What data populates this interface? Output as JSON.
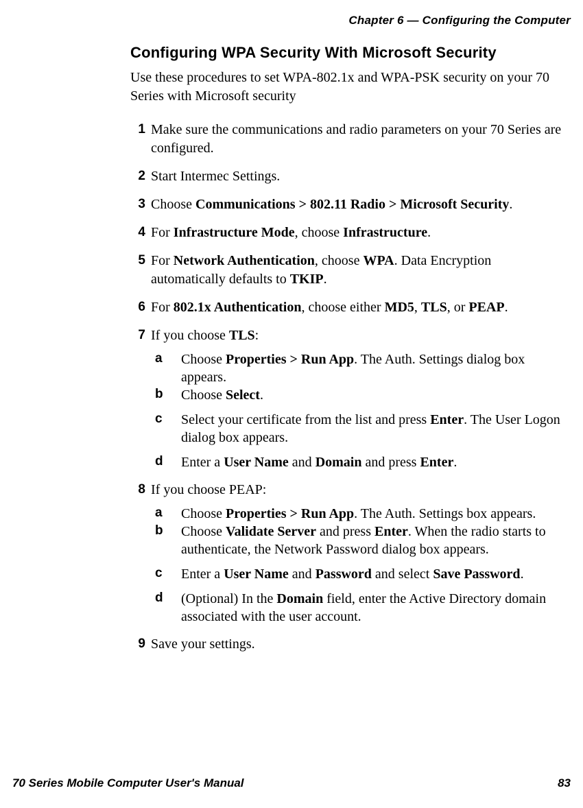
{
  "running_head": "Chapter 6 — Configuring the Computer",
  "section_title": "Configuring WPA Security With Microsoft Security",
  "intro": "Use these procedures to set WPA-802.1x and WPA-PSK security on your 70 Series with Microsoft security",
  "steps": {
    "s1": "Make sure the communications and radio parameters on your 70 Series are configured.",
    "s2": "Start Intermec Settings.",
    "s3_pre": "Choose ",
    "s3_bold": "Communications > 802.11 Radio > Microsoft Security",
    "s3_post": ".",
    "s4_a": "For ",
    "s4_b": "Infrastructure Mode",
    "s4_c": ", choose ",
    "s4_d": "Infrastructure",
    "s4_e": ".",
    "s5_a": "For ",
    "s5_b": "Network Authentication",
    "s5_c": ", choose ",
    "s5_d": "WPA",
    "s5_e": ". Data Encryption automatically defaults to ",
    "s5_f": "TKIP",
    "s5_g": ".",
    "s6_a": "For ",
    "s6_b": "802.1x Authentication",
    "s6_c": ", choose either ",
    "s6_d": "MD5",
    "s6_e": ", ",
    "s6_f": "TLS",
    "s6_g": ", or ",
    "s6_h": "PEAP",
    "s6_i": ".",
    "s7_a": "If you choose ",
    "s7_b": "TLS",
    "s7_c": ":",
    "s7_sub_a_1": "Choose ",
    "s7_sub_a_2": "Properties >  Run App",
    "s7_sub_a_3": ". The Auth. Settings dialog box appears.",
    "s7_sub_b_1": "Choose ",
    "s7_sub_b_2": "Select",
    "s7_sub_b_3": ".",
    "s7_sub_c_1": "Select your certificate from the list and press ",
    "s7_sub_c_2": "Enter",
    "s7_sub_c_3": ". The User Logon dialog box appears.",
    "s7_sub_d_1": "Enter a ",
    "s7_sub_d_2": "User Name",
    "s7_sub_d_3": " and ",
    "s7_sub_d_4": "Domain",
    "s7_sub_d_5": " and press ",
    "s7_sub_d_6": "Enter",
    "s7_sub_d_7": ".",
    "s8": "If you choose PEAP:",
    "s8_sub_a_1": "Choose ",
    "s8_sub_a_2": "Properties > Run App",
    "s8_sub_a_3": ". The Auth. Settings box appears.",
    "s8_sub_b_1": "Choose ",
    "s8_sub_b_2": "Validate Server",
    "s8_sub_b_3": " and press ",
    "s8_sub_b_4": "Enter",
    "s8_sub_b_5": ". When the radio starts to authenticate, the Network Password dialog box appears.",
    "s8_sub_c_1": "Enter a ",
    "s8_sub_c_2": "User Name",
    "s8_sub_c_3": " and ",
    "s8_sub_c_4": "Password",
    "s8_sub_c_5": " and select ",
    "s8_sub_c_6": "Save Password",
    "s8_sub_c_7": ".",
    "s8_sub_d_1": "(Optional) In the ",
    "s8_sub_d_2": "Domain",
    "s8_sub_d_3": " field, enter the Active Directory domain associated with the user account.",
    "s9": "Save your settings."
  },
  "footer": {
    "title": "70 Series Mobile Computer User's Manual",
    "page": "83"
  }
}
